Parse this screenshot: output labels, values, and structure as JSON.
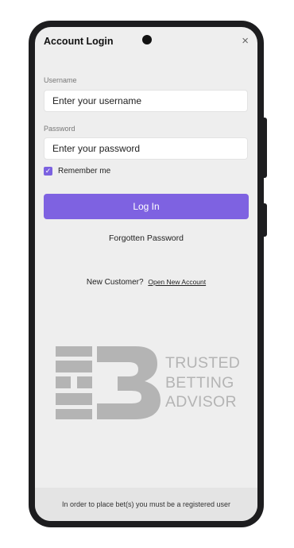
{
  "modal": {
    "title": "Account Login",
    "close_glyph": "×"
  },
  "form": {
    "username_label": "Username",
    "username_placeholder": "Enter your username",
    "password_label": "Password",
    "password_placeholder": "Enter your password",
    "remember_label": "Remember me",
    "remember_checked": true,
    "login_label": "Log In",
    "forgot_label": "Forgotten Password"
  },
  "signup": {
    "prompt": "New Customer?",
    "link_label": "Open New Account"
  },
  "logo": {
    "lines": [
      "TRUSTED",
      "BETTING",
      "ADVISOR"
    ],
    "color": "#b4b4b4"
  },
  "footer": {
    "text": "In order to place bet(s) you must be a registered user"
  },
  "colors": {
    "accent": "#7e62e1",
    "background": "#eeeeee"
  }
}
